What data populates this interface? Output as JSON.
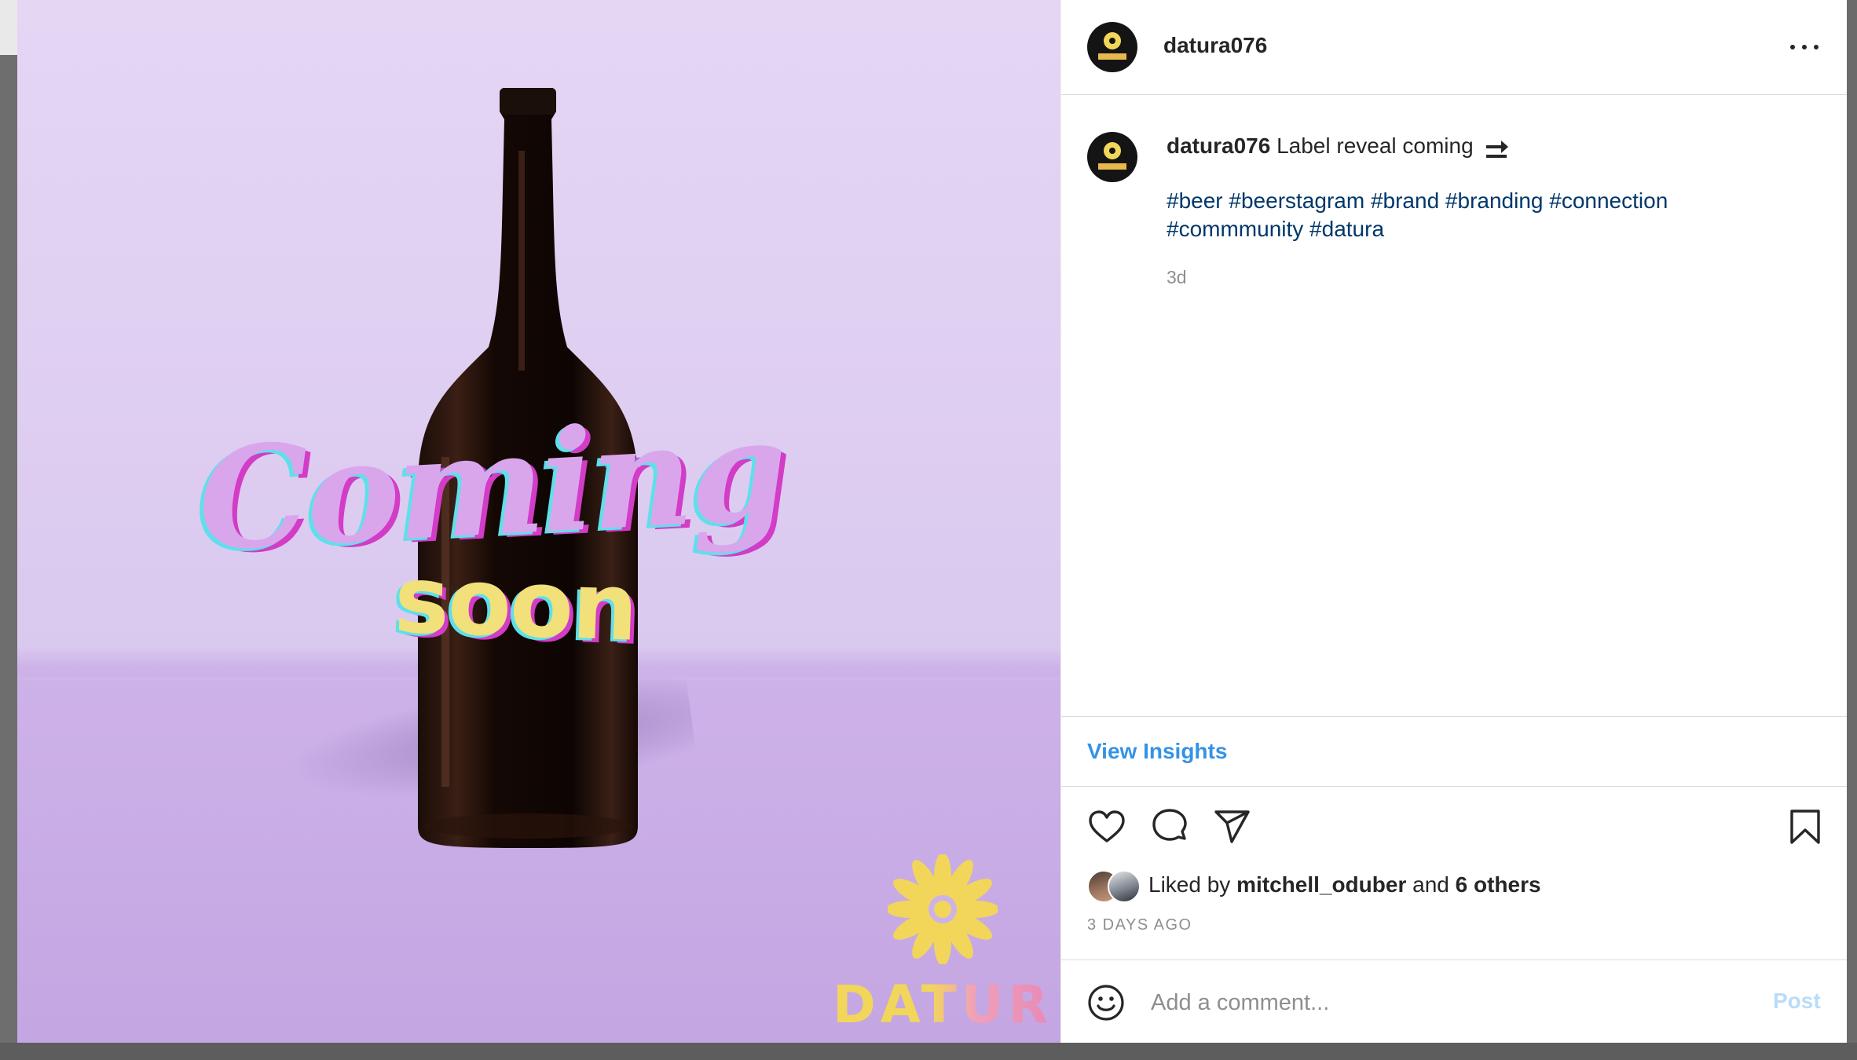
{
  "post": {
    "username": "datura076",
    "image": {
      "headline": "Coming",
      "subheadline": "soon",
      "brand_wordmark": "DATURA"
    },
    "caption": {
      "username": "datura076",
      "text": "Label reveal coming",
      "emoji": "soon-arrow-emoji",
      "hashtags": [
        "#beer",
        "#beerstagram",
        "#brand",
        "#branding",
        "#connection",
        "#commmunity",
        "#datura"
      ],
      "age": "3d"
    },
    "insights_label": "View Insights",
    "likes": {
      "prefix": "Liked by",
      "first_liker": "mitchell_oduber",
      "conjunction": "and",
      "others": "6 others"
    },
    "timestamp": "3 DAYS AGO",
    "comment": {
      "placeholder": "Add a comment...",
      "post_label": "Post"
    }
  },
  "icons": {
    "more": "more-horizontal-icon",
    "like": "heart-icon",
    "comment": "comment-bubble-icon",
    "share": "paper-plane-icon",
    "save": "bookmark-icon",
    "emoji": "smiley-icon"
  },
  "colors": {
    "link_blue": "#3493e5",
    "hashtag_blue": "#00376b",
    "post_disabled": "#b9dcf9",
    "media_lavender": "#dac9ef",
    "brand_yellow": "#f2d65a"
  }
}
